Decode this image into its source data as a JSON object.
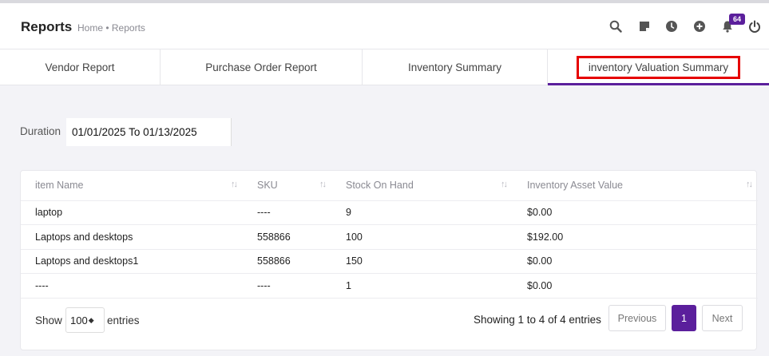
{
  "header": {
    "title": "Reports",
    "breadcrumb": "Home • Reports",
    "icons": [
      "search-icon",
      "note-icon",
      "clock-icon",
      "plus-circle-icon",
      "bell-icon",
      "power-icon"
    ],
    "notification_count": "64"
  },
  "tabs": [
    {
      "label": "Vendor Report",
      "active": false
    },
    {
      "label": "Purchase Order Report",
      "active": false
    },
    {
      "label": "Inventory Summary",
      "active": false
    },
    {
      "label": "inventory Valuation Summary",
      "active": true
    }
  ],
  "filter": {
    "duration_label": "Duration",
    "duration_value": "01/01/2025 To 01/13/2025"
  },
  "table": {
    "columns": [
      "item Name",
      "SKU",
      "Stock On Hand",
      "Inventory Asset Value"
    ],
    "rows": [
      [
        "laptop",
        "----",
        "9",
        "$0.00"
      ],
      [
        "Laptops and desktops",
        "558866",
        "100",
        "$192.00"
      ],
      [
        "Laptops and desktops1",
        "558866",
        "150",
        "$0.00"
      ],
      [
        "----",
        "----",
        "1",
        "$0.00"
      ]
    ]
  },
  "footer": {
    "show_label": "Show",
    "page_length": "100",
    "entries_label": "entries",
    "info": "Showing 1 to 4 of 4 entries",
    "previous": "Previous",
    "current_page": "1",
    "next": "Next"
  },
  "colors": {
    "accent": "#5b1f9c",
    "highlight": "#e60000"
  }
}
